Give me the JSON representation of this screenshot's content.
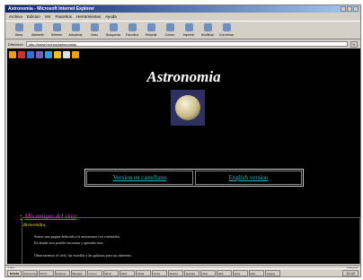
{
  "window": {
    "title": "Astronomia - Microsoft Internet Explorer"
  },
  "menu": [
    "Archivo",
    "Edicion",
    "Ver",
    "Favoritos",
    "Herramientas",
    "Ayuda"
  ],
  "toolbar": [
    "Atras",
    "Adelante",
    "Detener",
    "Actualizar",
    "Inicio",
    "Busqueda",
    "Favoritos",
    "Historial",
    "Correo",
    "Imprimir",
    "Modificar",
    "Conversar"
  ],
  "address": {
    "label": "Direccion",
    "value": "http://www.rsm.es/astronomia/",
    "go": "Ir"
  },
  "iconstrip": {
    "colors": [
      "#e8a020",
      "#d03030",
      "#3070d0",
      "#7060c0",
      "#30a0d0",
      "#f0c020",
      "#e0e0e0",
      "#f0a000"
    ]
  },
  "page": {
    "title": "Astronomia",
    "lang_links": [
      "Version en castellano",
      "English version"
    ],
    "travel_link": "Mis amigos del viaje",
    "greeting": "Bienvenidos,",
    "paragraphs": [
      "Somos una pagina dedicada a la astronomia con contenidos.",
      "En donde sera posible encontrar y aprender mas.",
      "Observaremos el cielo, las estrellas y las galaxias para sus intereses."
    ]
  },
  "status": {
    "text": "Listo",
    "zone": "Internet"
  },
  "taskbar": {
    "start": "Inicio",
    "tasks": [
      "Astronomia",
      "Mi PC",
      "Explorer",
      "Bandeja",
      "Correo",
      "Word",
      "Paint",
      "Notas",
      "Fotos",
      "Musica",
      "Agenda",
      "Chat",
      "Web",
      "Docs",
      "Red",
      "Juegos"
    ],
    "clock": "10:42"
  },
  "colors": {
    "link": "#2db6c8",
    "travel": "#d23cd2",
    "greeting": "#f0e33c",
    "title_gradient": "#0a246a"
  }
}
